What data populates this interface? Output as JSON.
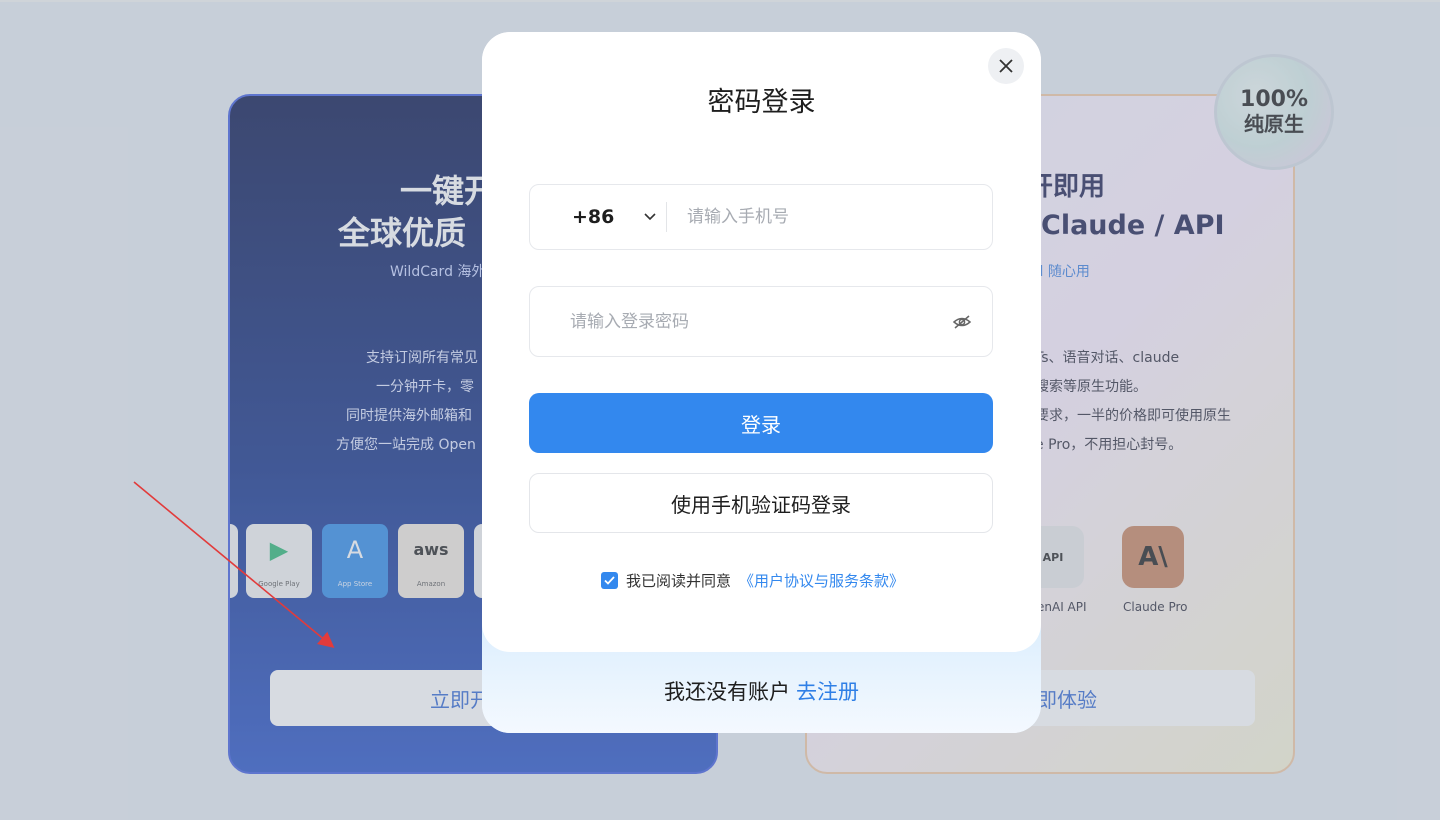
{
  "left_card": {
    "title_line1": "一键开",
    "title_line2": "全球优质",
    "subtitle": "WildCard 海外",
    "desc": [
      "支持订阅所有常见",
      "一分钟开卡，零",
      "同时提供海外邮箱和",
      "方便您一站完成 Open"
    ],
    "icons": [
      {
        "name": "Google Play",
        "glyph": "▶"
      },
      {
        "name": "App Store",
        "glyph": "A"
      },
      {
        "name": "Amazon",
        "glyph": "aws"
      }
    ],
    "cta": "立即开"
  },
  "right_card": {
    "title_line1": "开即用",
    "title_line2": "Claude / API",
    "subtitle": "rd 随心用",
    "desc": [
      "Ts、语音对话、claude",
      "搜索等原生功能。",
      "要求，一半的价格即可使用原生",
      "e Pro，不用担心封号。"
    ],
    "icons": [
      {
        "label": "enAI API",
        "glyph": "API"
      },
      {
        "label": "Claude Pro",
        "glyph": "A\\"
      }
    ],
    "cta": "即体验",
    "badge_line1": "100%",
    "badge_line2": "纯原生"
  },
  "modal": {
    "title": "密码登录",
    "country_code": "+86",
    "phone_placeholder": "请输入手机号",
    "password_placeholder": "请输入登录密码",
    "login_label": "登录",
    "sms_login_label": "使用手机验证码登录",
    "agree_text": "我已阅读并同意",
    "agree_link": "《用户协议与服务条款》",
    "no_account_text": "我还没有账户",
    "register_link": "去注册"
  },
  "colors": {
    "primary": "#3388ee",
    "link": "#2f7fe6",
    "arrow": "#e23b3b"
  }
}
